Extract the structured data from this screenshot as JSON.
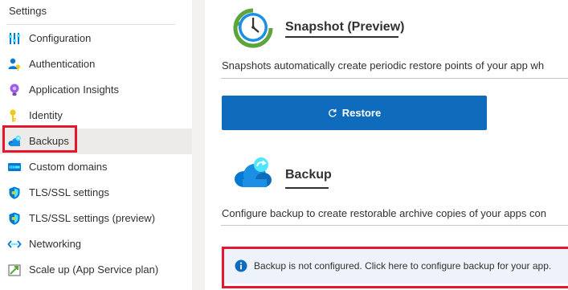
{
  "sidebar": {
    "heading": "Settings",
    "items": [
      {
        "label": "Configuration",
        "icon": "configuration-icon"
      },
      {
        "label": "Authentication",
        "icon": "authentication-icon"
      },
      {
        "label": "Application Insights",
        "icon": "application-insights-icon"
      },
      {
        "label": "Identity",
        "icon": "identity-icon"
      },
      {
        "label": "Backups",
        "icon": "backups-cloud-icon",
        "active": true
      },
      {
        "label": "Custom domains",
        "icon": "custom-domains-icon"
      },
      {
        "label": "TLS/SSL settings",
        "icon": "shield-icon"
      },
      {
        "label": "TLS/SSL settings (preview)",
        "icon": "shield-icon"
      },
      {
        "label": "Networking",
        "icon": "networking-icon"
      },
      {
        "label": "Scale up (App Service plan)",
        "icon": "scale-up-icon"
      }
    ]
  },
  "main": {
    "snapshot": {
      "title": "Snapshot (Preview)",
      "description": "Snapshots automatically create periodic restore points of your app wh",
      "restore_label": "Restore",
      "icon": "clock-icon"
    },
    "backup": {
      "title": "Backup",
      "description": "Configure backup to create restorable archive copies of your apps con",
      "icon": "cloud-backup-icon"
    },
    "info_banner": {
      "text": "Backup is not configured. Click here to configure backup for your app.",
      "icon": "info-icon"
    }
  },
  "colors": {
    "accent": "#0f6cbd",
    "highlight": "#e3182d",
    "active_nav": "#edebe9",
    "info_background": "#eef3fb"
  }
}
